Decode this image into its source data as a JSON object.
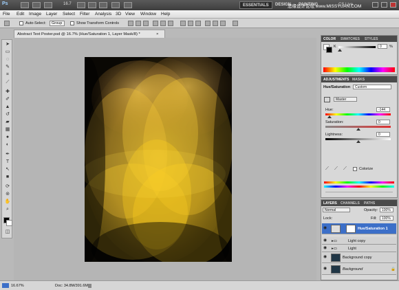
{
  "app_bar": {
    "logo": "Ps",
    "zoom": "16.7",
    "workspaces": [
      "ESSENTIALS",
      "DESIGN",
      "PAINTING"
    ],
    "cs_live": "CS Live",
    "watermark": "思缘设计论坛 www.MISSYUAN.COM"
  },
  "menu": [
    "File",
    "Edit",
    "Image",
    "Layer",
    "Select",
    "Filter",
    "Analysis",
    "3D",
    "View",
    "Window",
    "Help"
  ],
  "options": {
    "auto_select_label": "Auto-Select:",
    "auto_select_value": "Group",
    "show_transform": "Show Transform Controls"
  },
  "document": {
    "tab_title": "Abstract Text Poster.psd @ 16.7% (Hue/Saturation 1, Layer Mask/8) *",
    "close": "×"
  },
  "status": {
    "zoom": "16.67%",
    "doc_info": "Doc: 34.8M/391.6M"
  },
  "color_panel": {
    "tabs": [
      "COLOR",
      "SWATCHES",
      "STYLES"
    ],
    "k_label": "K",
    "k_value": "0",
    "k_unit": "%"
  },
  "adjustments": {
    "tabs": [
      "ADJUSTMENTS",
      "MASKS"
    ],
    "title": "Hue/Saturation",
    "preset": "Custom",
    "channel": "Master",
    "hue_label": "Hue:",
    "hue_value": "-144",
    "saturation_label": "Saturation:",
    "saturation_value": "0",
    "lightness_label": "Lightness:",
    "lightness_value": "0",
    "colorize_label": "Colorize"
  },
  "layers": {
    "tabs": [
      "LAYERS",
      "CHANNELS",
      "PATHS"
    ],
    "blend_mode": "Normal",
    "opacity_label": "Opacity:",
    "opacity_value": "100%",
    "lock_label": "Lock:",
    "fill_label": "Fill:",
    "fill_value": "100%",
    "items": [
      {
        "name": "Hue/Saturation 1"
      },
      {
        "name": "Light copy"
      },
      {
        "name": "Light"
      },
      {
        "name": "Background copy"
      },
      {
        "name": "Background"
      }
    ]
  },
  "colors": {
    "ps_blue": "#3c6fc8",
    "ui_dark": "#3d3d3d",
    "ui_light": "#d8d8d8",
    "art_yellow": "#f2c21c"
  }
}
